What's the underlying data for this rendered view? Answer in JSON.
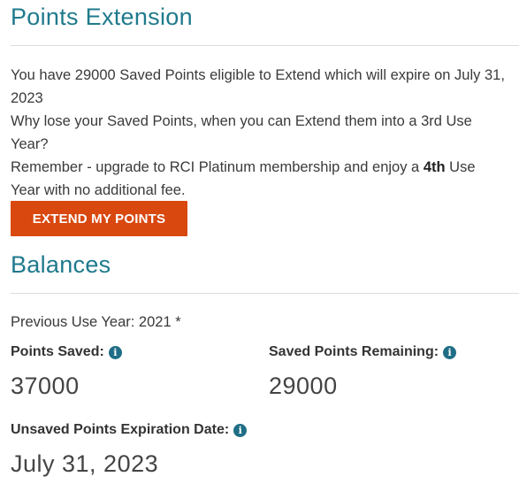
{
  "extension": {
    "title": "Points Extension",
    "line1": "You have 29000  Saved Points eligible to Extend which will expire on July 31, 2023",
    "line2": "Why lose your Saved Points, when you can Extend them into a 3rd Use Year?",
    "line3_pre": "Remember - upgrade to RCI Platinum membership and enjoy a ",
    "line3_bold": "4th",
    "line3_post": " Use Year with no additional fee.",
    "button_label": "EXTEND MY POINTS"
  },
  "balances": {
    "title": "Balances",
    "previous_use_year": "Previous Use Year: 2021 *",
    "points_saved_label": "Points Saved:",
    "points_saved_value": "37000",
    "saved_remaining_label": "Saved Points Remaining:",
    "saved_remaining_value": "29000",
    "unsaved_expiration_label": "Unsaved Points Expiration Date:",
    "unsaved_expiration_value": "July 31, 2023"
  },
  "icons": {
    "info_glyph": "i"
  },
  "colors": {
    "heading": "#1f7a8c",
    "button": "#d8480f",
    "info_icon": "#1f6e86"
  }
}
